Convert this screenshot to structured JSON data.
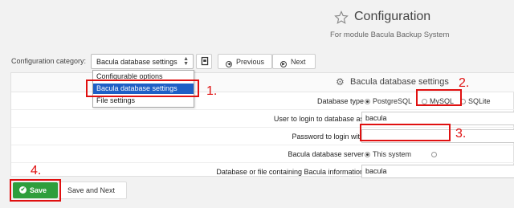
{
  "header": {
    "title": "Configuration",
    "subtitle": "For module Bacula Backup System"
  },
  "toolbar": {
    "category_label": "Configuration category:",
    "category_value": "Bacula database settings",
    "prev_label": "Previous",
    "next_label": "Next"
  },
  "dropdown": {
    "options": [
      "Configurable options",
      "Bacula database settings",
      "File settings"
    ],
    "selected_index": 1
  },
  "panel": {
    "title": "Bacula database settings",
    "rows": [
      {
        "label": "Database type",
        "options": [
          "PostgreSQL",
          "MySQL",
          "SQLite"
        ],
        "checked": "PostgreSQL"
      },
      {
        "label": "User to login to database as",
        "value": "bacula"
      },
      {
        "label": "Password to login with",
        "value": ""
      },
      {
        "label": "Bacula database server",
        "option": "This system"
      },
      {
        "label": "Database or file containing Bacula information",
        "value": "bacula"
      }
    ]
  },
  "actions": {
    "save_label": "Save",
    "save_next_label": "Save and Next"
  },
  "annotations": [
    "1.",
    "2.",
    "3.",
    "4."
  ],
  "colors": {
    "save_green": "#2e9e3c",
    "select_blue": "#1e5fc6",
    "annotation_red": "#e01010"
  }
}
